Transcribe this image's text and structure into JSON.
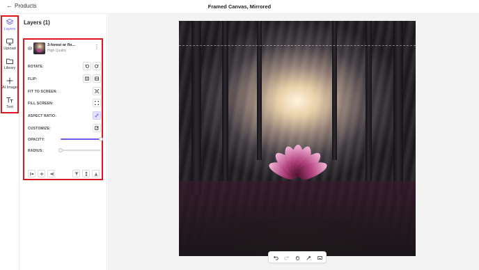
{
  "header": {
    "back_label": "Products",
    "title": "Framed Canvas, Mirrored"
  },
  "rail": {
    "items": [
      {
        "label": "Layers",
        "icon": "layers-icon",
        "active": true
      },
      {
        "label": "Upload",
        "icon": "upload-icon"
      },
      {
        "label": "Library",
        "icon": "folder-icon"
      },
      {
        "label": "AI Image",
        "icon": "sparkle-icon"
      },
      {
        "label": "Text",
        "icon": "text-icon"
      }
    ]
  },
  "panel": {
    "title": "Layers (1)",
    "layer": {
      "name": "3-forest or flo...",
      "quality": "High Quality"
    },
    "rows": {
      "rotate": "ROTATE:",
      "flip": "FLIP:",
      "fit": "FIT TO SCREEN:",
      "fill": "FILL SCREEN:",
      "aspect": "ASPECT RATIO:",
      "customize": "CUSTOMIZE:",
      "opacity": "OPACITY:",
      "radius": "RADIUS:"
    },
    "opacity_value": 1.0,
    "radius_value": 0.0
  },
  "colors": {
    "accent": "#6a5cf6",
    "highlight_box": "#e0141c"
  },
  "toolbar": {
    "tools": [
      "undo-icon",
      "redo-icon",
      "hand-icon",
      "eyedropper-icon",
      "keyboard-icon"
    ]
  }
}
